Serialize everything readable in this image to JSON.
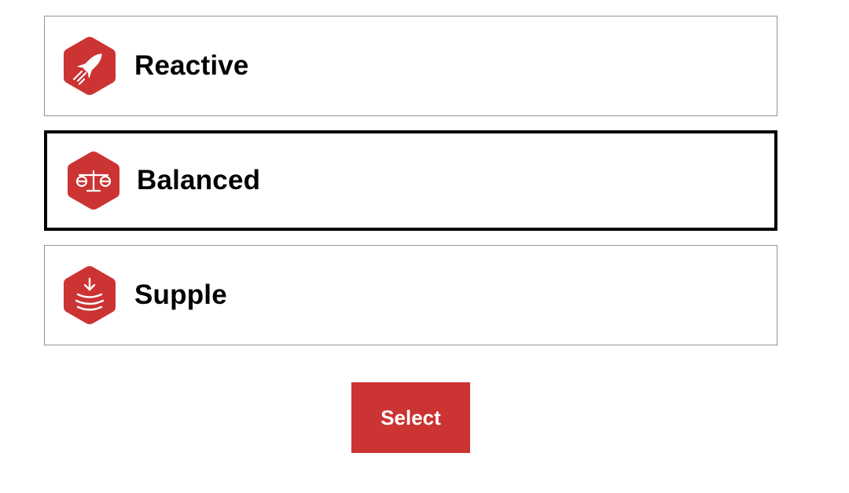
{
  "options": [
    {
      "label": "Reactive",
      "icon": "rocket-icon",
      "selected": false
    },
    {
      "label": "Balanced",
      "icon": "scales-icon",
      "selected": true
    },
    {
      "label": "Supple",
      "icon": "cushion-icon",
      "selected": false
    }
  ],
  "select_button": {
    "label": "Select"
  },
  "colors": {
    "accent": "#cc3333",
    "selected_border": "#000000",
    "default_border": "#8f9696"
  }
}
